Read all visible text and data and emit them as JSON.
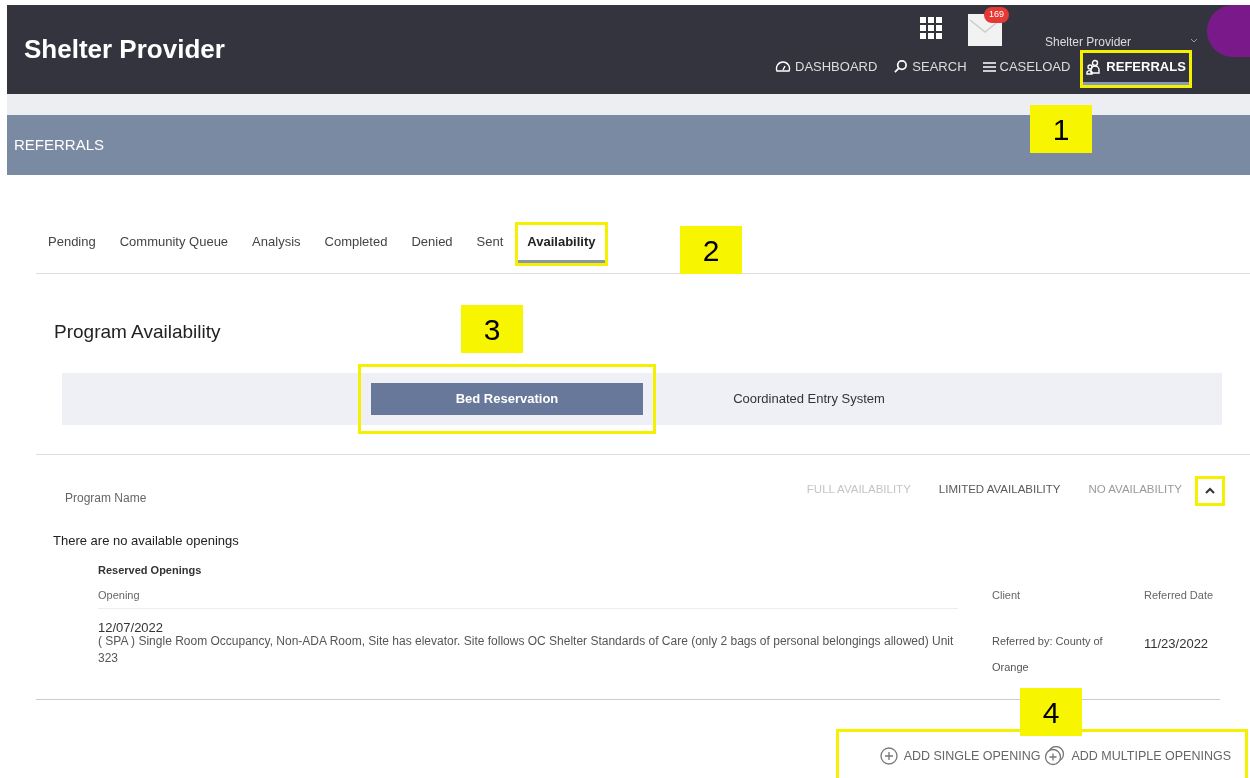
{
  "header": {
    "title": "Shelter Provider",
    "mail_count": "169",
    "user": "Shelter Provider",
    "nav": [
      {
        "kind": "dashboard",
        "label": "DASHBOARD",
        "selected": false,
        "highlighted": false
      },
      {
        "kind": "search",
        "label": "SEARCH",
        "selected": false,
        "highlighted": false
      },
      {
        "kind": "caseload",
        "label": "CASELOAD",
        "selected": false,
        "highlighted": false
      },
      {
        "kind": "referrals",
        "label": "REFERRALS",
        "selected": true,
        "highlighted": true
      }
    ]
  },
  "page_title": "REFERRALS",
  "tabs": [
    {
      "label": "Pending",
      "selected": false,
      "highlighted": false
    },
    {
      "label": "Community Queue",
      "selected": false,
      "highlighted": false
    },
    {
      "label": "Analysis",
      "selected": false,
      "highlighted": false
    },
    {
      "label": "Completed",
      "selected": false,
      "highlighted": false
    },
    {
      "label": "Denied",
      "selected": false,
      "highlighted": false
    },
    {
      "label": "Sent",
      "selected": false,
      "highlighted": false
    },
    {
      "label": "Availability",
      "selected": true,
      "highlighted": true
    }
  ],
  "section_title": "Program Availability",
  "segments": [
    {
      "label": "Bed Reservation",
      "selected": true,
      "highlighted": true
    },
    {
      "label": "Coordinated Entry System",
      "selected": false,
      "highlighted": false
    }
  ],
  "program_header": {
    "label": "Program Name",
    "legend": [
      {
        "label": "FULL AVAILABILITY",
        "color": "#c4c4c4"
      },
      {
        "label": "LIMITED AVAILABILITY",
        "color": "#5a5a5a"
      },
      {
        "label": "NO AVAILABILITY",
        "color": "#9a9a9a"
      }
    ],
    "collapse_highlighted": true
  },
  "empty_message": "There are no available openings",
  "reserved": {
    "title": "Reserved Openings",
    "columns": [
      "Opening",
      "Client",
      "Referred Date"
    ],
    "rows": [
      {
        "date": "12/07/2022",
        "description": "(   SPA   ) Single Room Occupancy, Non-ADA Room, Site has elevator. Site follows OC Shelter Standards of Care (only 2 bags of personal belongings allowed) Unit 323",
        "client": "Referred by: County of Orange",
        "referred_date": "11/23/2022"
      }
    ]
  },
  "actions": {
    "highlighted": true,
    "buttons": [
      {
        "kind": "single",
        "label": "ADD SINGLE OPENING"
      },
      {
        "kind": "multiple",
        "label": "ADD MULTIPLE OPENINGS"
      }
    ]
  },
  "callouts": [
    {
      "label": "1"
    },
    {
      "label": "2"
    },
    {
      "label": "3"
    },
    {
      "label": "4"
    }
  ]
}
